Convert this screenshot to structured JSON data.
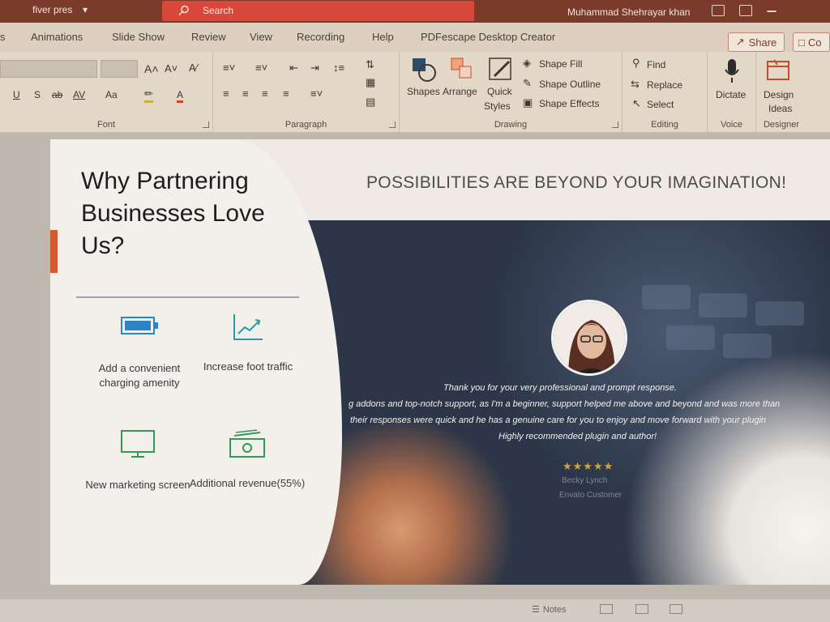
{
  "titlebar": {
    "file_name": "fiver pres",
    "search_label": "Search",
    "user_name": "Muhammad Shehrayar khan",
    "controls": [
      "coauthor-icon",
      "ribbon-display-icon",
      "minimize-icon"
    ]
  },
  "menubar": {
    "tabs": [
      "s",
      "Animations",
      "Slide Show",
      "Review",
      "View",
      "Recording",
      "Help",
      "PDFescape Desktop Creator"
    ],
    "share_label": "Share",
    "comments_label": "Co"
  },
  "ribbon": {
    "font": {
      "label": "Font",
      "grow_font": "A˄",
      "shrink_font": "A˅",
      "char_spacing": "AV",
      "change_case": "Aa",
      "underline": "U",
      "shadow": "S",
      "strikethrough": "ab",
      "font_color": "A"
    },
    "paragraph": {
      "label": "Paragraph"
    },
    "drawing": {
      "label": "Drawing",
      "shapes": "Shapes",
      "arrange": "Arrange",
      "quick_styles_1": "Quick",
      "quick_styles_2": "Styles",
      "shape_fill": "Shape Fill",
      "shape_outline": "Shape Outline",
      "shape_effects": "Shape Effects"
    },
    "editing": {
      "label": "Editing",
      "find": "Find",
      "replace": "Replace",
      "select": "Select"
    },
    "voice": {
      "label": "Voice",
      "dictate": "Dictate"
    },
    "designer": {
      "label": "Designer",
      "design_ideas_1": "Design",
      "design_ideas_2": "Ideas"
    }
  },
  "slide": {
    "title": "Why Partnering Businesses Love Us?",
    "subtitle": "POSSIBILITIES ARE BEYOND YOUR IMAGINATION!",
    "features": [
      {
        "icon": "battery-icon",
        "label": "Add a convenient charging amenity"
      },
      {
        "icon": "growth-chart-icon",
        "label": "Increase foot traffic"
      },
      {
        "icon": "monitor-icon",
        "label": "New marketing screen"
      },
      {
        "icon": "money-icon",
        "label": "Additional revenue(55%)"
      }
    ],
    "testimonial": {
      "line1": "Thank you for your very professional and prompt response.",
      "line2": "g addons and top-notch support, as I'm a beginner, support helped me above and beyond and was more than",
      "line3": "their responses were quick and he has a genuine care for you to enjoy and move forward with your plugin",
      "line4": "Highly recommended plugin and author!",
      "stars": "★★★★★",
      "rating": 5,
      "name": "Becky Lynch",
      "role": "Envato Customer"
    }
  },
  "statusbar": {
    "notes_label": "Notes"
  },
  "colors": {
    "title_bar": "#7a3b2a",
    "search_box": "#d9473a",
    "slide_accent": "#d65a2c",
    "icon_blue": "#2a86c9",
    "icon_teal": "#2a9ba6",
    "icon_green": "#2f9a5a",
    "star": "#cfa63b"
  }
}
